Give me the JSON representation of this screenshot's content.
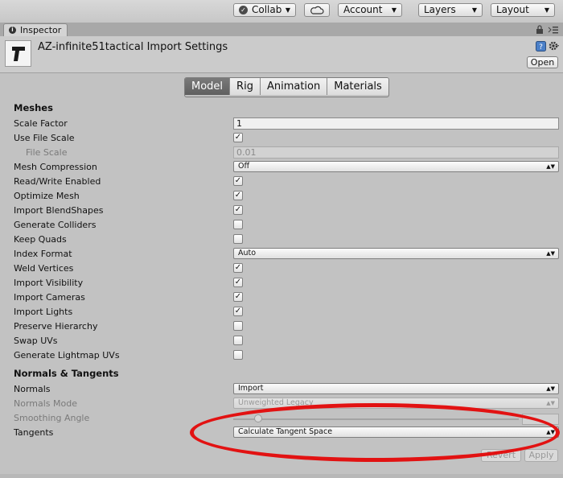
{
  "toolbar": {
    "collab_label": "Collab",
    "account_label": "Account",
    "layers_label": "Layers",
    "layout_label": "Layout"
  },
  "tabs": {
    "inspector_label": "Inspector"
  },
  "header": {
    "title": "AZ-infinite51tactical Import Settings",
    "open_label": "Open"
  },
  "model_tabs": [
    "Model",
    "Rig",
    "Animation",
    "Materials"
  ],
  "active_model_tab": "Model",
  "meshes": {
    "section_label": "Meshes",
    "scale_factor": {
      "label": "Scale Factor",
      "value": "1"
    },
    "use_file_scale": {
      "label": "Use File Scale",
      "checked": true
    },
    "file_scale": {
      "label": "File Scale",
      "value": "0.01"
    },
    "mesh_compression": {
      "label": "Mesh Compression",
      "value": "Off"
    },
    "read_write": {
      "label": "Read/Write Enabled",
      "checked": true
    },
    "optimize_mesh": {
      "label": "Optimize Mesh",
      "checked": true
    },
    "import_blendshapes": {
      "label": "Import BlendShapes",
      "checked": true
    },
    "generate_colliders": {
      "label": "Generate Colliders",
      "checked": false
    },
    "keep_quads": {
      "label": "Keep Quads",
      "checked": false
    },
    "index_format": {
      "label": "Index Format",
      "value": "Auto"
    },
    "weld_vertices": {
      "label": "Weld Vertices",
      "checked": true
    },
    "import_visibility": {
      "label": "Import Visibility",
      "checked": true
    },
    "import_cameras": {
      "label": "Import Cameras",
      "checked": true
    },
    "import_lights": {
      "label": "Import Lights",
      "checked": true
    },
    "preserve_hierarchy": {
      "label": "Preserve Hierarchy",
      "checked": false
    },
    "swap_uvs": {
      "label": "Swap UVs",
      "checked": false
    },
    "generate_lightmap_uvs": {
      "label": "Generate Lightmap UVs",
      "checked": false
    }
  },
  "normals": {
    "section_label": "Normals & Tangents",
    "normals": {
      "label": "Normals",
      "value": "Import"
    },
    "normals_mode": {
      "label": "Normals Mode",
      "value": "Unweighted Legacy"
    },
    "smoothing_angle": {
      "label": "Smoothing Angle",
      "value": "",
      "fraction": 0.09
    },
    "tangents": {
      "label": "Tangents",
      "value": "Calculate Tangent Space"
    }
  },
  "footer": {
    "revert_label": "Revert",
    "apply_label": "Apply"
  },
  "colors": {
    "annotation": "#e21212",
    "background": "#c2c2c2",
    "active_tab": "#6a6a6a"
  }
}
